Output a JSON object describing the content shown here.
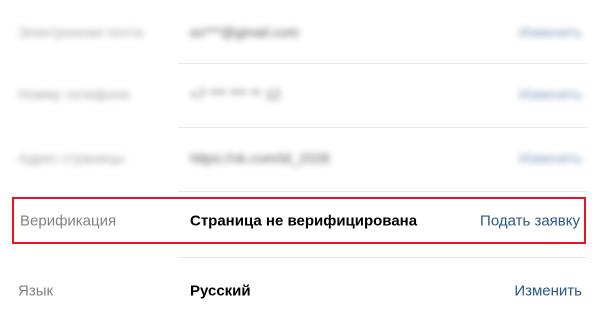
{
  "settings": {
    "rows": [
      {
        "label": "Электронная почта",
        "value": "ex***@gmail.com",
        "action": "Изменить"
      },
      {
        "label": "Номер телефона",
        "value": "+7 *** *** ** 12",
        "action": "Изменить"
      },
      {
        "label": "Адрес страницы",
        "value": "https://vk.com/id_2026",
        "action": "Изменить"
      }
    ],
    "verification": {
      "label": "Верификация",
      "value": "Страница не верифицирована",
      "action": "Подать заявку"
    },
    "language": {
      "label": "Язык",
      "value": "Русский",
      "action": "Изменить"
    }
  },
  "colors": {
    "highlight_border": "#e8141e",
    "link": "#2a5885",
    "label": "#828282"
  }
}
